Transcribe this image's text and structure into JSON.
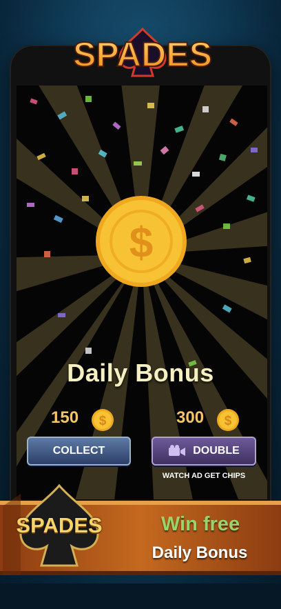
{
  "app": {
    "logo_text": "SPADES"
  },
  "bonus": {
    "title": "Daily Bonus",
    "collect_amount": "150",
    "double_amount": "300",
    "collect_label": "COLLECT",
    "double_label": "DOUBLE",
    "watch_label": "WATCH AD GET CHIPS"
  },
  "banner": {
    "logo_text": "SPADES",
    "headline": "Win free",
    "subheadline": "Daily Bonus"
  },
  "icons": {
    "coin": "dollar-coin-icon",
    "camera": "video-camera-icon"
  },
  "colors": {
    "coin": "#f7c233",
    "button_blue": "#3c5282",
    "button_purple": "#4f3a77",
    "headline_green": "#9bd26a"
  }
}
